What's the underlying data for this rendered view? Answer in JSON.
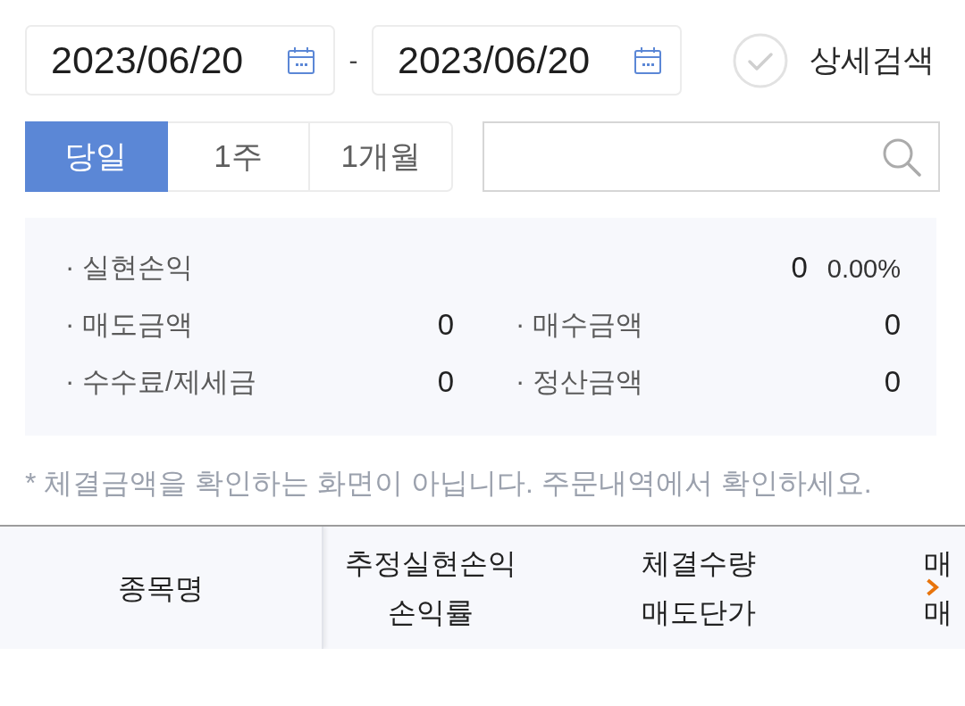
{
  "date_range": {
    "start": "2023/06/20",
    "separator": "-",
    "end": "2023/06/20"
  },
  "detail_search": {
    "label": "상세검색",
    "checked": false
  },
  "period_tabs": [
    {
      "label": "당일",
      "selected": true
    },
    {
      "label": "1주",
      "selected": false
    },
    {
      "label": "1개월",
      "selected": false
    }
  ],
  "summary": {
    "realized_profit": {
      "label": "· 실현손익",
      "value": "0",
      "rate": "0.00%"
    },
    "items": [
      {
        "label": "· 매도금액",
        "value": "0"
      },
      {
        "label": "· 매수금액",
        "value": "0"
      },
      {
        "label": "· 수수료/제세금",
        "value": "0"
      },
      {
        "label": "· 정산금액",
        "value": "0"
      }
    ]
  },
  "notice": "* 체결금액을 확인하는 화면이 아닙니다. 주문내역에서 확인하세요.",
  "table": {
    "columns": [
      {
        "lines": [
          "종목명"
        ]
      },
      {
        "lines": [
          "추정실현손익",
          "손익률"
        ]
      },
      {
        "lines": [
          "체결수량",
          "매도단가"
        ]
      },
      {
        "lines": [
          "매",
          "매"
        ]
      }
    ]
  }
}
